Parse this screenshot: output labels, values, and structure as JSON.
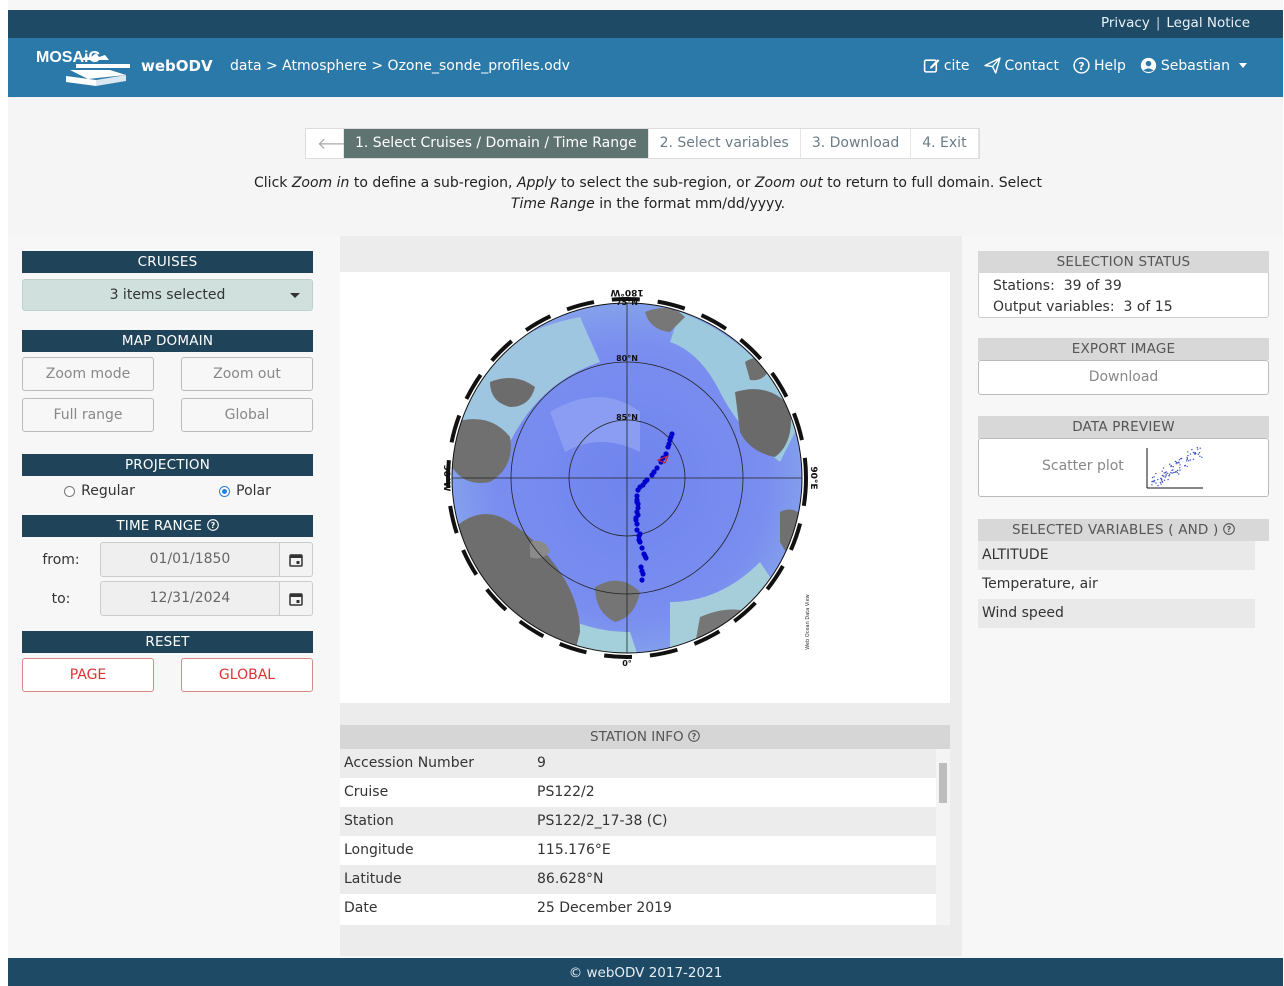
{
  "topbar": {
    "privacy": "Privacy",
    "separator": "|",
    "legal": "Legal Notice"
  },
  "header": {
    "logo_text": "MOSAiC",
    "brand": "webODV",
    "breadcrumb": "data > Atmosphere > Ozone_sonde_profiles.odv",
    "nav": {
      "cite": "cite",
      "contact": "Contact",
      "help": "Help",
      "user": "Sebastian"
    }
  },
  "wizard": {
    "steps": [
      "1. Select Cruises / Domain / Time Range",
      "2. Select variables",
      "3. Download",
      "4. Exit"
    ],
    "active_step": 0,
    "instruction": {
      "p1": "Click ",
      "zoom_in": "Zoom in",
      "p2": " to define a sub-region, ",
      "apply": "Apply",
      "p3": " to select the sub-region, or ",
      "zoom_out": "Zoom out",
      "p4": " to return to full domain. Select ",
      "time_range": "Time Range",
      "p5": " in the format mm/dd/yyyy."
    }
  },
  "left": {
    "cruises": {
      "title": "CRUISES",
      "selected": "3 items selected"
    },
    "map_domain": {
      "title": "MAP DOMAIN",
      "zoom_mode": "Zoom mode",
      "zoom_out": "Zoom out",
      "full_range": "Full range",
      "global": "Global"
    },
    "projection": {
      "title": "PROJECTION",
      "regular": "Regular",
      "polar": "Polar",
      "selected": "Polar"
    },
    "time_range": {
      "title": "TIME RANGE",
      "from_label": "from:",
      "from": "01/01/1850",
      "to_label": "to:",
      "to": "12/31/2024"
    },
    "reset": {
      "title": "RESET",
      "page": "PAGE",
      "global": "GLOBAL"
    }
  },
  "map": {
    "lat_labels": [
      "75°N",
      "80°N",
      "85°N"
    ],
    "lon_labels": {
      "top": "180°W",
      "left": "90°W",
      "right": "90°E",
      "bottom": "0°"
    },
    "watermark": "Web Ocean Data View",
    "stations_count": 39
  },
  "station_info": {
    "title": "STATION INFO",
    "rows": [
      {
        "key": "Accession Number",
        "value": "9"
      },
      {
        "key": "Cruise",
        "value": "PS122/2"
      },
      {
        "key": "Station",
        "value": "PS122/2_17-38 (C)"
      },
      {
        "key": "Longitude",
        "value": "115.176°E"
      },
      {
        "key": "Latitude",
        "value": "86.628°N"
      },
      {
        "key": "Date",
        "value": "25 December 2019"
      }
    ]
  },
  "right": {
    "selection_status": {
      "title": "SELECTION STATUS",
      "stations_label": "Stations:",
      "stations": "39 of 39",
      "outvars_label": "Output variables:",
      "outvars": "3 of 15"
    },
    "export_image": {
      "title": "EXPORT IMAGE",
      "download": "Download"
    },
    "data_preview": {
      "title": "DATA PREVIEW",
      "label": "Scatter plot"
    },
    "selected_variables": {
      "title": "SELECTED VARIABLES ( AND )",
      "items": [
        "ALTITUDE",
        "Temperature, air",
        "Wind speed"
      ]
    }
  },
  "footer": {
    "text": "© webODV 2017-2021"
  },
  "colors": {
    "topbar": "#1e4a66",
    "header": "#2b79a8",
    "section_dark": "#1f4459",
    "active_step": "#5f7470",
    "reset_red": "#dd3333",
    "station_dots": "#0000cc"
  }
}
